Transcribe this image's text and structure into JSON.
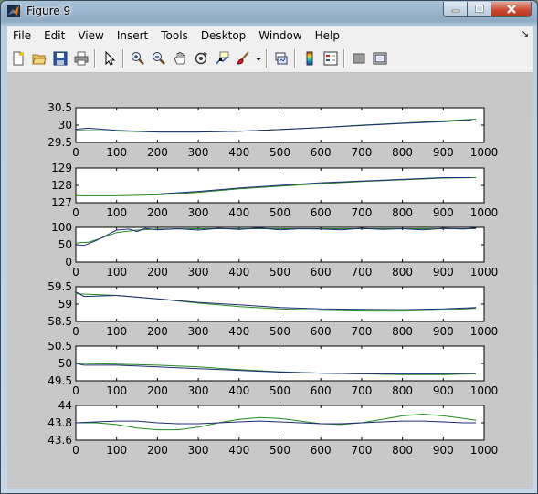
{
  "window": {
    "title": "Figure 9",
    "controls": [
      "minimize",
      "maximize",
      "close"
    ]
  },
  "menubar": {
    "items": [
      "File",
      "Edit",
      "View",
      "Insert",
      "Tools",
      "Desktop",
      "Window",
      "Help"
    ]
  },
  "toolbar": {
    "icons": [
      "new-figure-icon",
      "open-file-icon",
      "save-icon",
      "print-icon",
      "pointer-icon",
      "zoom-in-icon",
      "zoom-out-icon",
      "pan-icon",
      "rotate-3d-icon",
      "data-cursor-icon",
      "brush-icon",
      "link-plot-icon",
      "colorbar-icon",
      "legend-icon",
      "hide-plot-tools-icon",
      "show-plot-tools-icon"
    ]
  },
  "colors": {
    "series_dark": "#1f2a78",
    "series_green": "#1e8c1e",
    "figure_background": "#c8c8c8"
  },
  "chart_data": [
    {
      "type": "line",
      "xlim": [
        0,
        1000
      ],
      "ylim": [
        29.5,
        30.5
      ],
      "xticks": [
        0,
        100,
        200,
        300,
        400,
        500,
        600,
        700,
        800,
        900,
        1000
      ],
      "yticks": [
        "29.5",
        "30",
        "30.5"
      ],
      "series": [
        {
          "color": "#1f2a78",
          "x": [
            0,
            30,
            100,
            200,
            300,
            400,
            500,
            600,
            700,
            800,
            900,
            970
          ],
          "y": [
            29.88,
            29.91,
            29.85,
            29.8,
            29.8,
            29.82,
            29.87,
            29.93,
            29.99,
            30.05,
            30.1,
            30.15
          ]
        },
        {
          "color": "#1e8c1e",
          "x": [
            0,
            100,
            200,
            300,
            400,
            500,
            600,
            700,
            800,
            900,
            980
          ],
          "y": [
            29.85,
            29.83,
            29.8,
            29.8,
            29.82,
            29.87,
            29.93,
            30.0,
            30.06,
            30.12,
            30.17
          ]
        }
      ]
    },
    {
      "type": "line",
      "xlim": [
        0,
        1000
      ],
      "ylim": [
        127,
        129
      ],
      "xticks": [
        0,
        100,
        200,
        300,
        400,
        500,
        600,
        700,
        800,
        900,
        1000
      ],
      "yticks": [
        "127",
        "128",
        "129"
      ],
      "series": [
        {
          "color": "#1f2a78",
          "x": [
            0,
            100,
            200,
            300,
            400,
            500,
            600,
            700,
            800,
            900,
            970
          ],
          "y": [
            127.5,
            127.5,
            127.5,
            127.65,
            127.85,
            128.0,
            128.15,
            128.25,
            128.35,
            128.45,
            128.45
          ]
        },
        {
          "color": "#1e8c1e",
          "x": [
            0,
            100,
            200,
            300,
            400,
            500,
            600,
            700,
            800,
            900,
            980
          ],
          "y": [
            127.4,
            127.4,
            127.45,
            127.6,
            127.8,
            127.95,
            128.1,
            128.22,
            128.32,
            128.42,
            128.45
          ]
        }
      ]
    },
    {
      "type": "line",
      "xlim": [
        0,
        1000
      ],
      "ylim": [
        0,
        100
      ],
      "xticks": [
        0,
        100,
        200,
        300,
        400,
        500,
        600,
        700,
        800,
        900,
        1000
      ],
      "yticks": [
        "0",
        "50",
        "100"
      ],
      "series": [
        {
          "color": "#1f2a78",
          "x": [
            0,
            20,
            50,
            100,
            130,
            150,
            170,
            200,
            250,
            300,
            350,
            400,
            450,
            500,
            550,
            600,
            650,
            700,
            750,
            800,
            850,
            900,
            950,
            980
          ],
          "y": [
            50,
            48,
            62,
            92,
            95,
            88,
            97,
            93,
            96,
            92,
            97,
            94,
            98,
            93,
            96,
            95,
            93,
            97,
            94,
            96,
            93,
            97,
            95,
            98
          ]
        },
        {
          "color": "#1e8c1e",
          "x": [
            0,
            30,
            60,
            100,
            150,
            200,
            300,
            400,
            500,
            600,
            700,
            800,
            900,
            980
          ],
          "y": [
            55,
            57,
            68,
            85,
            92,
            95,
            96,
            96,
            96,
            96,
            96,
            96,
            96,
            96
          ]
        }
      ]
    },
    {
      "type": "line",
      "xlim": [
        0,
        1000
      ],
      "ylim": [
        58.5,
        59.5
      ],
      "xticks": [
        0,
        100,
        200,
        300,
        400,
        500,
        600,
        700,
        800,
        900,
        1000
      ],
      "yticks": [
        "58.5",
        "59",
        "59.5"
      ],
      "series": [
        {
          "color": "#1f2a78",
          "x": [
            0,
            20,
            100,
            200,
            300,
            400,
            500,
            600,
            700,
            800,
            900,
            980
          ],
          "y": [
            59.35,
            59.22,
            59.25,
            59.15,
            59.05,
            58.98,
            58.9,
            58.86,
            58.85,
            58.84,
            58.86,
            58.9
          ]
        },
        {
          "color": "#1e8c1e",
          "x": [
            0,
            100,
            200,
            300,
            400,
            500,
            600,
            700,
            800,
            900,
            980
          ],
          "y": [
            59.3,
            59.25,
            59.15,
            59.03,
            58.93,
            58.86,
            58.82,
            58.8,
            58.8,
            58.83,
            58.88
          ]
        }
      ]
    },
    {
      "type": "line",
      "xlim": [
        0,
        1000
      ],
      "ylim": [
        49.5,
        50.5
      ],
      "xticks": [
        0,
        100,
        200,
        300,
        400,
        500,
        600,
        700,
        800,
        900,
        1000
      ],
      "yticks": [
        "49.5",
        "50",
        "50.5"
      ],
      "series": [
        {
          "color": "#1f2a78",
          "x": [
            0,
            20,
            100,
            200,
            300,
            400,
            500,
            600,
            700,
            800,
            900,
            980
          ],
          "y": [
            50.0,
            49.95,
            49.95,
            49.9,
            49.85,
            49.8,
            49.75,
            49.72,
            49.7,
            49.7,
            49.7,
            49.72
          ]
        },
        {
          "color": "#1e8c1e",
          "x": [
            0,
            100,
            200,
            300,
            400,
            500,
            600,
            700,
            800,
            900,
            980
          ],
          "y": [
            50.0,
            49.98,
            49.95,
            49.9,
            49.82,
            49.76,
            49.72,
            49.7,
            49.68,
            49.68,
            49.7
          ]
        }
      ]
    },
    {
      "type": "line",
      "xlim": [
        0,
        1000
      ],
      "ylim": [
        43.6,
        44
      ],
      "xticks": [
        0,
        100,
        200,
        300,
        400,
        500,
        600,
        700,
        800,
        900,
        1000
      ],
      "yticks": [
        "43.6",
        "43.8",
        "44"
      ],
      "series": [
        {
          "color": "#1f2a78",
          "x": [
            0,
            50,
            100,
            150,
            200,
            250,
            300,
            350,
            400,
            450,
            500,
            550,
            600,
            650,
            700,
            750,
            800,
            850,
            900,
            950,
            980
          ],
          "y": [
            43.8,
            43.81,
            43.82,
            43.82,
            43.8,
            43.79,
            43.79,
            43.8,
            43.81,
            43.82,
            43.81,
            43.8,
            43.79,
            43.79,
            43.8,
            43.81,
            43.82,
            43.82,
            43.81,
            43.8,
            43.8
          ]
        },
        {
          "color": "#1e8c1e",
          "x": [
            0,
            50,
            100,
            150,
            200,
            250,
            300,
            350,
            400,
            450,
            500,
            550,
            600,
            650,
            700,
            750,
            800,
            850,
            900,
            950,
            980
          ],
          "y": [
            43.8,
            43.8,
            43.78,
            43.74,
            43.72,
            43.72,
            43.75,
            43.8,
            43.84,
            43.86,
            43.85,
            43.82,
            43.79,
            43.78,
            43.8,
            43.84,
            43.88,
            43.9,
            43.88,
            43.85,
            43.83
          ]
        }
      ]
    }
  ]
}
